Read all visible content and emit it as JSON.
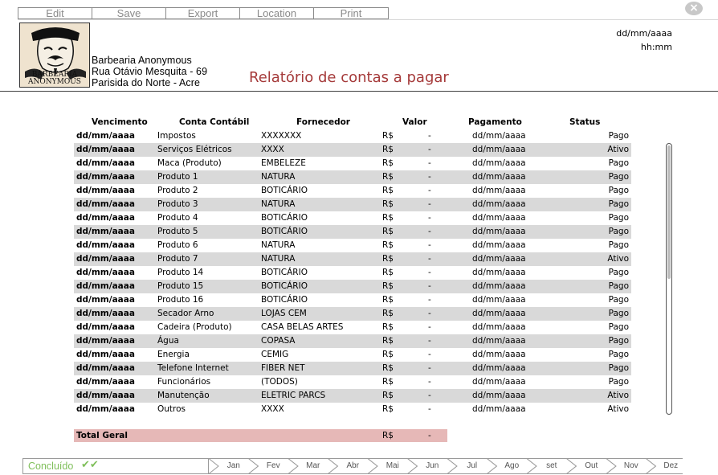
{
  "toolbar": {
    "items": [
      "Edit",
      "Save",
      "Export",
      "Location",
      "Print"
    ],
    "close_label": "×"
  },
  "header": {
    "logo_text_line1": "BARBEARIA",
    "logo_text_line2": "ANONYMOUS",
    "company_name": "Barbearia Anonymous",
    "address_line1": "Rua Otávio Mesquita - 69",
    "address_line2": "Parisida do Norte - Acre",
    "title": "Relatório de contas a pagar",
    "date": "dd/mm/aaaa",
    "time": "hh:mm"
  },
  "table": {
    "columns": [
      "Vencimento",
      "Conta Contábil",
      "Fornecedor",
      "Valor",
      "Pagamento",
      "Status"
    ],
    "rows": [
      {
        "venc": "dd/mm/aaaa",
        "conta": "Impostos",
        "forn": "XXXXXXX",
        "rs": "R$",
        "valor": "-",
        "pag": "dd/mm/aaaa",
        "status": "Pago"
      },
      {
        "venc": "dd/mm/aaaa",
        "conta": "Serviços Elétricos",
        "forn": "XXXX",
        "rs": "R$",
        "valor": "-",
        "pag": "dd/mm/aaaa",
        "status": "Ativo"
      },
      {
        "venc": "dd/mm/aaaa",
        "conta": "Maca (Produto)",
        "forn": "EMBELEZE",
        "rs": "R$",
        "valor": "-",
        "pag": "dd/mm/aaaa",
        "status": "Pago"
      },
      {
        "venc": "dd/mm/aaaa",
        "conta": "Produto 1",
        "forn": "NATURA",
        "rs": "R$",
        "valor": "-",
        "pag": "dd/mm/aaaa",
        "status": "Pago"
      },
      {
        "venc": "dd/mm/aaaa",
        "conta": "Produto 2",
        "forn": "BOTICÁRIO",
        "rs": "R$",
        "valor": "-",
        "pag": "dd/mm/aaaa",
        "status": "Pago"
      },
      {
        "venc": "dd/mm/aaaa",
        "conta": "Produto 3",
        "forn": "NATURA",
        "rs": "R$",
        "valor": "-",
        "pag": "dd/mm/aaaa",
        "status": "Pago"
      },
      {
        "venc": "dd/mm/aaaa",
        "conta": "Produto 4",
        "forn": "BOTICÁRIO",
        "rs": "R$",
        "valor": "-",
        "pag": "dd/mm/aaaa",
        "status": "Pago"
      },
      {
        "venc": "dd/mm/aaaa",
        "conta": "Produto 5",
        "forn": "BOTICÁRIO",
        "rs": "R$",
        "valor": "-",
        "pag": "dd/mm/aaaa",
        "status": "Pago"
      },
      {
        "venc": "dd/mm/aaaa",
        "conta": "Produto 6",
        "forn": "NATURA",
        "rs": "R$",
        "valor": "-",
        "pag": "dd/mm/aaaa",
        "status": "Pago"
      },
      {
        "venc": "dd/mm/aaaa",
        "conta": "Produto 7",
        "forn": "NATURA",
        "rs": "R$",
        "valor": "-",
        "pag": "dd/mm/aaaa",
        "status": "Ativo"
      },
      {
        "venc": "dd/mm/aaaa",
        "conta": "Produto 14",
        "forn": "BOTICÁRIO",
        "rs": "R$",
        "valor": "-",
        "pag": "dd/mm/aaaa",
        "status": "Pago"
      },
      {
        "venc": "dd/mm/aaaa",
        "conta": "Produto 15",
        "forn": "BOTICÁRIO",
        "rs": "R$",
        "valor": "-",
        "pag": "dd/mm/aaaa",
        "status": "Pago"
      },
      {
        "venc": "dd/mm/aaaa",
        "conta": "Produto 16",
        "forn": "BOTICÁRIO",
        "rs": "R$",
        "valor": "-",
        "pag": "dd/mm/aaaa",
        "status": "Pago"
      },
      {
        "venc": "dd/mm/aaaa",
        "conta": "Secador Arno",
        "forn": "LOJAS CEM",
        "rs": "R$",
        "valor": "-",
        "pag": "dd/mm/aaaa",
        "status": "Pago"
      },
      {
        "venc": "dd/mm/aaaa",
        "conta": "Cadeira (Produto)",
        "forn": "CASA BELAS ARTES",
        "rs": "R$",
        "valor": "-",
        "pag": "dd/mm/aaaa",
        "status": "Pago"
      },
      {
        "venc": "dd/mm/aaaa",
        "conta": "Água",
        "forn": "COPASA",
        "rs": "R$",
        "valor": "-",
        "pag": "dd/mm/aaaa",
        "status": "Pago"
      },
      {
        "venc": "dd/mm/aaaa",
        "conta": "Energia",
        "forn": "CEMIG",
        "rs": "R$",
        "valor": "-",
        "pag": "dd/mm/aaaa",
        "status": "Pago"
      },
      {
        "venc": "dd/mm/aaaa",
        "conta": "Telefone Internet",
        "forn": "FIBER NET",
        "rs": "R$",
        "valor": "-",
        "pag": "dd/mm/aaaa",
        "status": "Pago"
      },
      {
        "venc": "dd/mm/aaaa",
        "conta": "Funcionários",
        "forn": "(TODOS)",
        "rs": "R$",
        "valor": "-",
        "pag": "dd/mm/aaaa",
        "status": "Pago"
      },
      {
        "venc": "dd/mm/aaaa",
        "conta": "Manutenção",
        "forn": "ELETRIC PARCS",
        "rs": "R$",
        "valor": "-",
        "pag": "dd/mm/aaaa",
        "status": "Ativo"
      },
      {
        "venc": "dd/mm/aaaa",
        "conta": "Outros",
        "forn": "XXXX",
        "rs": "R$",
        "valor": "-",
        "pag": "dd/mm/aaaa",
        "status": "Ativo"
      }
    ],
    "total": {
      "label": "Total Geral",
      "rs": "R$",
      "valor": "-"
    }
  },
  "status_bar": {
    "done_label": "Concluído",
    "months": [
      "Jan",
      "Fev",
      "Mar",
      "Abr",
      "Mai",
      "Jun",
      "Jul",
      "Ago",
      "set",
      "Out",
      "Nov",
      "Dez"
    ]
  },
  "colors": {
    "title": "#a53a3a",
    "row_shade": "#d9d9d9",
    "total_bg": "#e6b8b7",
    "done": "#7fbf5a"
  }
}
